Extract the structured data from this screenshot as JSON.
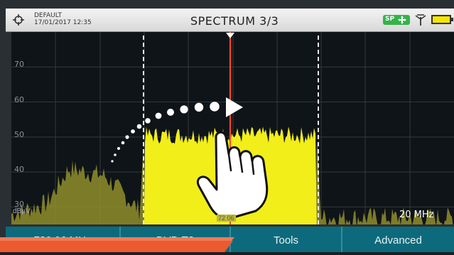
{
  "header": {
    "profile_name": "DEFAULT",
    "datetime": "17/01/2017 12:35",
    "title": "SPECTRUM 3/3",
    "sp_badge": "SP",
    "icons": [
      "target-icon",
      "move-icon",
      "antenna-icon",
      "battery-icon"
    ]
  },
  "plot": {
    "unit_label": "dBµV",
    "span_label": "20 MHz",
    "marker_freq_partial": "72  06",
    "colors": {
      "signal_main": "#f2ee1a",
      "signal_side": "#9c9b2e",
      "marker": "#ff4b1f",
      "grid": "#34393d"
    }
  },
  "softkeys": {
    "key1": "730.06 MHz",
    "key2": "DVB-T2",
    "key3": "Tools",
    "key4": "Advanced"
  },
  "chart_data": {
    "type": "area",
    "xlabel": "",
    "ylabel": "dBµV",
    "ylim": [
      25,
      80
    ],
    "y_ticks": [
      30,
      40,
      50,
      60,
      70
    ],
    "span": "20 MHz",
    "series": [
      {
        "x": [
          0,
          0.08,
          0.13,
          0.21,
          0.29,
          0.3,
          0.69,
          0.7,
          1.0
        ],
        "values": [
          28,
          31,
          41,
          39,
          29,
          50,
          50,
          27,
          27
        ]
      }
    ]
  }
}
